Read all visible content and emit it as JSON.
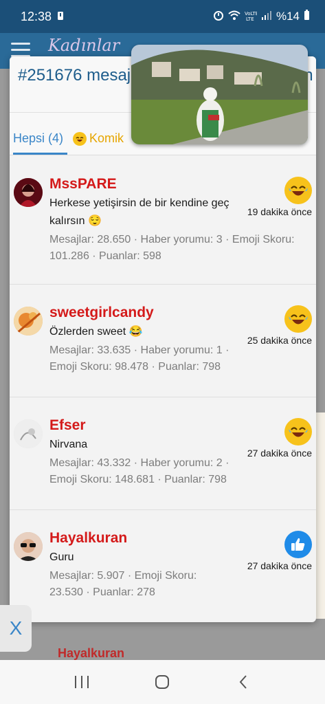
{
  "status_bar": {
    "time": "12:38",
    "battery_percent": "%14",
    "icons": [
      "alarm-icon",
      "wifi-icon",
      "volte-icon",
      "signal-icon",
      "battery-icon"
    ]
  },
  "background_app": {
    "logo_text": "Kadınlar",
    "peek_name": "Hayalkuran"
  },
  "modal": {
    "title": "#251676 mesaja emoji ile tepki gösteren üyeler",
    "tabs": [
      {
        "label": "Hepsi (4)",
        "active": true
      },
      {
        "label": "Komik",
        "emoji": "laugh",
        "active": false
      }
    ],
    "items": [
      {
        "name": "MssPARE",
        "message": "Herkese yetişirsin de bir kendine geç kalırsın 😌",
        "stats": "Mesajlar: 28.650 · Haber yorumu: 3 · Emoji Skoru: 101.286 · Puanlar: 598",
        "reaction": "laugh-emoji-icon",
        "time": "19 dakika önce",
        "avatar_color": "#8a1020"
      },
      {
        "name": "sweetgirlcandy",
        "message": "Özlerden sweet 😂",
        "stats": "Mesajlar: 33.635 · Haber yorumu: 1 · Emoji Skoru: 98.478 · Puanlar: 798",
        "reaction": "laugh-emoji-icon",
        "time": "25 dakika önce",
        "avatar_color": "#e8a040"
      },
      {
        "name": "Efser",
        "message": "Nirvana",
        "stats": "Mesajlar: 43.332 · Haber yorumu: 2 · Emoji Skoru: 148.681 · Puanlar: 798",
        "reaction": "laugh-emoji-icon",
        "time": "27 dakika önce",
        "avatar_color": "#d8d8d8"
      },
      {
        "name": "Hayalkuran",
        "message": "Guru",
        "stats": "Mesajlar: 5.907 · Emoji Skoru: 23.530 · Puanlar: 278",
        "reaction": "thumbs-up-icon",
        "time": "27 dakika önce",
        "avatar_color": "#c8a888"
      }
    ]
  },
  "close_label": "X",
  "colors": {
    "accent": "#3a86c8",
    "username": "#d41a1a",
    "header": "#1b4f78",
    "laugh_emoji": "#f7c21b",
    "like_emoji": "#1f8be8"
  }
}
